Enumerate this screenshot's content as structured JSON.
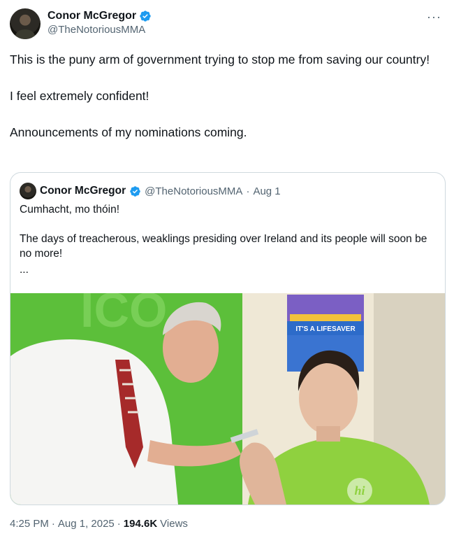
{
  "author": {
    "display_name": "Conor McGregor",
    "handle": "@TheNotoriousMMA",
    "avatar_icon": "user-avatar-icon",
    "verified_icon": "verified-badge-icon",
    "verified_color": "#1d9bf0"
  },
  "more_icon": "more-options-icon",
  "more_label": "···",
  "tweet": {
    "lines": [
      "This is the puny arm of government trying to stop me from saving our country!",
      "I feel extremely confident!",
      "Announcements of my nominations coming."
    ]
  },
  "quote": {
    "display_name": "Conor McGregor",
    "handle": "@TheNotoriousMMA",
    "separator": "·",
    "date": "Aug 1",
    "lines": [
      "Cumhacht, mo thóin!",
      "The days of treacherous, weaklings presiding over Ireland and its people will soon be no more!"
    ],
    "ellipsis": "...",
    "image": {
      "poster_text": "IT'S A LIFESAVER",
      "shirt_logo": "hi",
      "colors": {
        "green_wall": "#5cbf3a",
        "shirt": "#8fd13f",
        "poster": "#7b5fc4"
      }
    }
  },
  "footer": {
    "time": "4:25 PM",
    "separator1": "·",
    "date": "Aug 1, 2025",
    "separator2": "·",
    "views_count": "194.6K",
    "views_label": "Views"
  },
  "colors": {
    "text": "#0f1419",
    "muted": "#536471",
    "border": "#cfd9de"
  }
}
